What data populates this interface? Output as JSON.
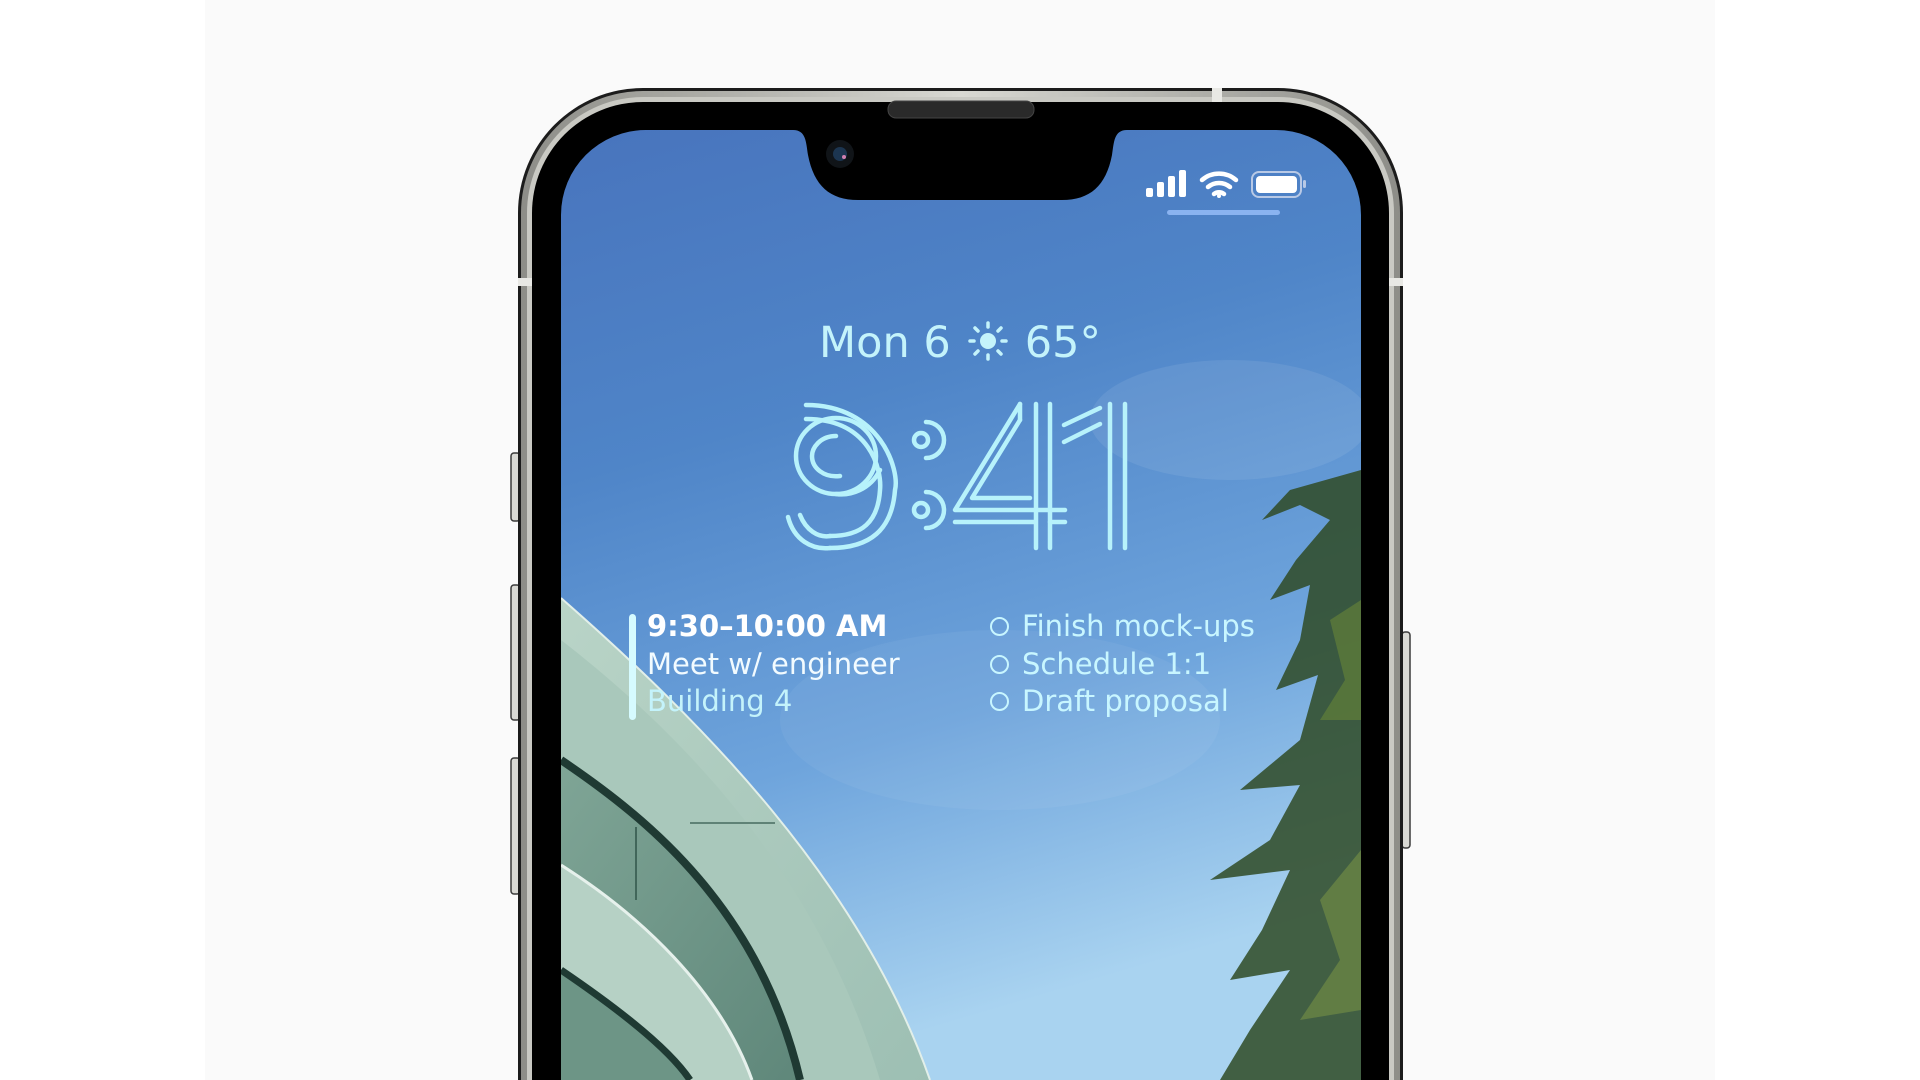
{
  "device": {
    "model": "iPhone",
    "screen": "lock-screen"
  },
  "status_bar": {
    "icons": [
      "cellular-signal-icon",
      "wifi-icon",
      "battery-icon"
    ],
    "signal_bars": 4,
    "battery_level": 1.0
  },
  "lock_screen": {
    "date": "Mon 6",
    "weather_icon": "sun-icon",
    "temperature": "65°",
    "time": "9:41",
    "colors": {
      "widget_text": "#c4f3fb",
      "sky_top": "#4a78bd",
      "sky_bottom": "#a9d3f0"
    }
  },
  "calendar_widget": {
    "time_range": "9:30–10:00 AM",
    "title": "Meet w/ engineer",
    "location": "Building 4"
  },
  "reminders_widget": {
    "items": [
      {
        "label": "Finish mock-ups",
        "done": false
      },
      {
        "label": "Schedule 1:1",
        "done": false
      },
      {
        "label": "Draft proposal",
        "done": false
      }
    ]
  }
}
